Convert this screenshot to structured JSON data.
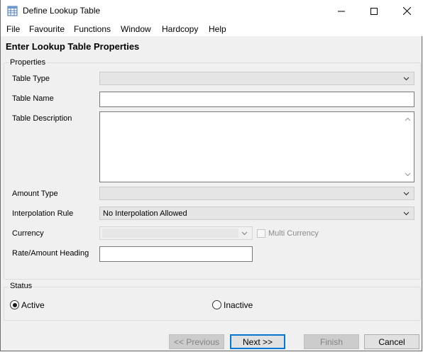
{
  "window": {
    "title": "Define Lookup Table",
    "icon": "table-icon",
    "controls": [
      "minimize-icon",
      "maximize-icon",
      "close-icon"
    ]
  },
  "menu": [
    "File",
    "Favourite",
    "Functions",
    "Window",
    "Hardcopy",
    "Help"
  ],
  "page_title": "Enter Lookup Table Properties",
  "properties": {
    "group_label": "Properties",
    "table_type": {
      "label": "Table Type",
      "value": ""
    },
    "table_name": {
      "label": "Table Name",
      "value": ""
    },
    "table_description": {
      "label": "Table Description",
      "value": ""
    },
    "amount_type": {
      "label": "Amount Type",
      "value": ""
    },
    "interpolation_rule": {
      "label": "Interpolation Rule",
      "value": "No Interpolation Allowed"
    },
    "currency": {
      "label": "Currency",
      "value": ""
    },
    "multi_currency": {
      "label": "Multi Currency",
      "checked": false
    },
    "rate_amount_heading": {
      "label": "Rate/Amount Heading",
      "value": ""
    }
  },
  "status": {
    "group_label": "Status",
    "active": {
      "label": "Active",
      "checked": true
    },
    "inactive": {
      "label": "Inactive",
      "checked": false
    }
  },
  "buttons": {
    "previous": "<< Previous",
    "next": "Next >>",
    "finish": "Finish",
    "cancel": "Cancel"
  }
}
